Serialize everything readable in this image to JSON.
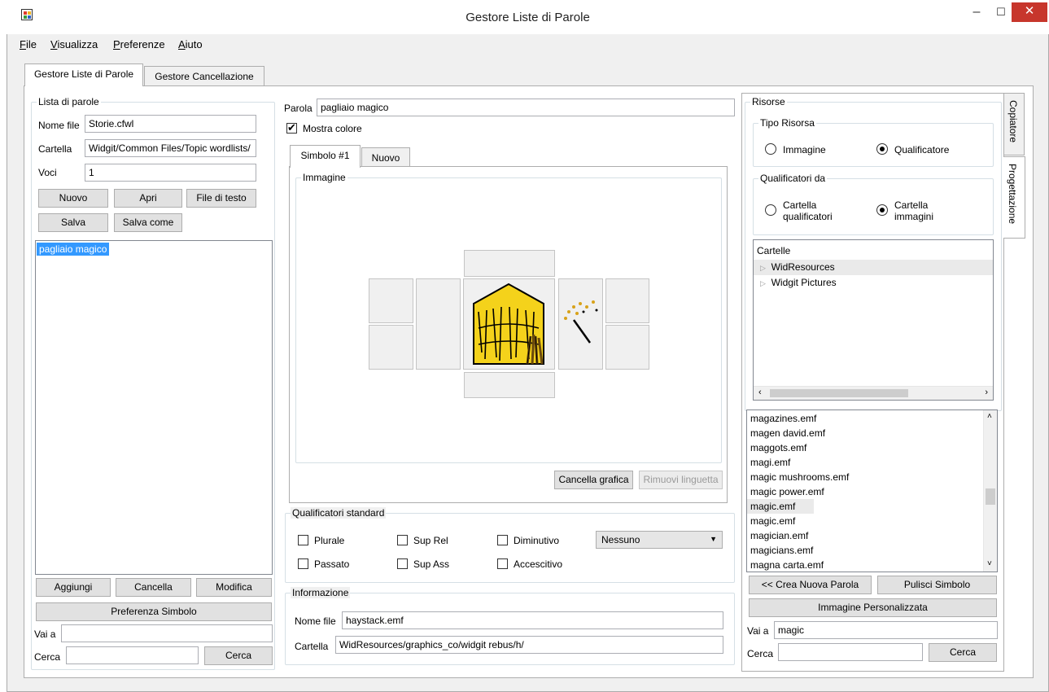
{
  "window": {
    "title": "Gestore Liste di Parole",
    "minimize": "–",
    "maximize": "☐",
    "close": "✕"
  },
  "menu": {
    "file": "File",
    "view": "Visualizza",
    "prefs": "Preferenze",
    "help": "Aiuto",
    "file_key": "F",
    "file_rest": "ile",
    "view_key": "V",
    "view_rest": "isualizza",
    "prefs_key": "P",
    "prefs_rest": "referenze",
    "help_key": "A",
    "help_rest": "iuto"
  },
  "tabs": [
    "Gestore Liste di Parole",
    "Gestore Cancellazione"
  ],
  "wordlist": {
    "group_title": "Lista di parole",
    "filename_label": "Nome file",
    "filename_value": "Storie.cfwl",
    "folder_label": "Cartella",
    "folder_value": "Widgit/Common Files/Topic wordlists/",
    "entries_label": "Voci",
    "entries_value": "1",
    "btn_new": "Nuovo",
    "btn_open": "Apri",
    "btn_text_file": "File di testo",
    "btn_save": "Salva",
    "btn_save_as": "Salva come",
    "items": [
      "pagliaio magico"
    ],
    "btn_add": "Aggiungi",
    "btn_delete": "Cancella",
    "btn_edit": "Modifica",
    "btn_symbol_pref": "Preferenza Simbolo",
    "goto_label": "Vai a",
    "goto_value": "",
    "search_label": "Cerca",
    "search_value": "",
    "search_btn": "Cerca"
  },
  "center": {
    "word_label": "Parola",
    "word_value": "pagliaio magico",
    "show_color_label": "Mostra colore",
    "show_color_checked": true,
    "symbol_tabs": [
      "Simbolo #1",
      "Nuovo"
    ],
    "image_group": "Immagine",
    "btn_clear_graphic": "Cancella grafica",
    "btn_remove_tab": "Rimuovi linguetta",
    "qualifiers_group": "Qualificatori standard",
    "q_plural": "Plurale",
    "q_sup_rel": "Sup Rel",
    "q_diminutive": "Diminutivo",
    "q_past": "Passato",
    "q_sup_ass": "Sup Ass",
    "q_augmentative": "Accescitivo",
    "q_dropdown": "Nessuno",
    "info_group": "Informazione",
    "info_filename_label": "Nome file",
    "info_filename_value": "haystack.emf",
    "info_folder_label": "Cartella",
    "info_folder_value": "WidResources/graphics_co/widgit rebus/h/"
  },
  "resources": {
    "group_title": "Risorse",
    "type_group": "Tipo Risorsa",
    "type_image": "Immagine",
    "type_qualifier": "Qualificatore",
    "type_selected": "qualifier",
    "from_group": "Qualificatori da",
    "from_q_folder_1": "Cartella",
    "from_q_folder_2": "qualificatori",
    "from_i_folder_1": "Cartella",
    "from_i_folder_2": "immagini",
    "folders_header": "Cartelle",
    "folders": [
      "WidResources",
      "Widgit Pictures"
    ],
    "files": [
      "magazines.emf",
      "magen david.emf",
      "maggots.emf",
      "magi.emf",
      "magic mushrooms.emf",
      "magic power.emf",
      "magic.emf",
      "magic.emf",
      "magician.emf",
      "magicians.emf",
      "magna carta.emf"
    ],
    "btn_create_word": "<< Crea Nuova Parola",
    "btn_clear_symbol": "Pulisci Simbolo",
    "btn_custom_image": "Immagine Personalizzata",
    "goto_label": "Vai a",
    "goto_value": "magic",
    "search_label": "Cerca",
    "search_value": "",
    "search_btn": "Cerca"
  },
  "side_tabs": [
    "Copiatore",
    "Progettazione"
  ]
}
